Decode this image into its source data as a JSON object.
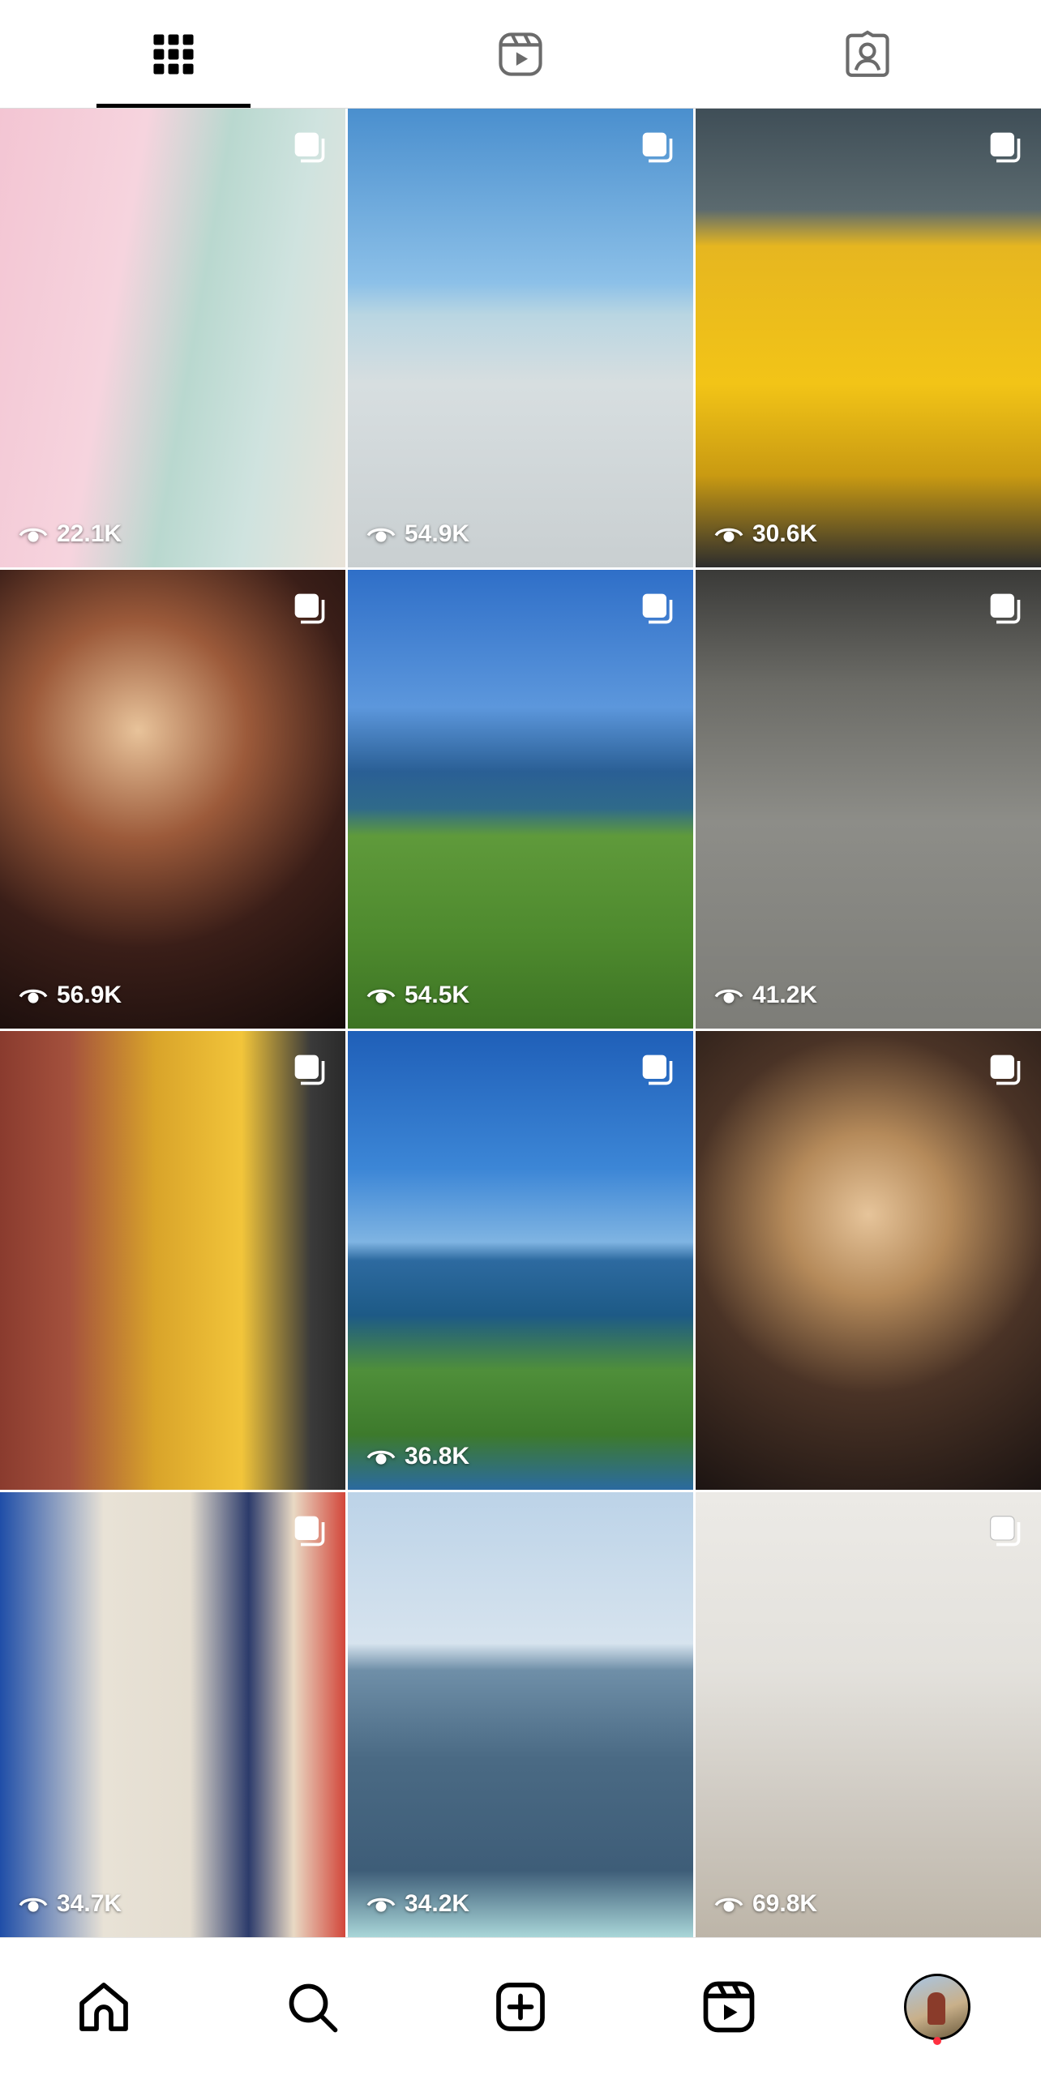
{
  "tabs": [
    {
      "name": "grid-icon",
      "active": true
    },
    {
      "name": "reels-icon",
      "active": false
    },
    {
      "name": "tagged-icon",
      "active": false
    }
  ],
  "posts": [
    {
      "views": "22.1K"
    },
    {
      "views": "54.9K"
    },
    {
      "views": "30.6K"
    },
    {
      "views": "56.9K"
    },
    {
      "views": "54.5K"
    },
    {
      "views": "41.2K"
    },
    {
      "views": ""
    },
    {
      "views": "36.8K"
    },
    {
      "views": ""
    },
    {
      "views": "34.7K"
    },
    {
      "views": "34.2K"
    },
    {
      "views": "69.8K"
    }
  ],
  "bottom_nav": [
    "home-icon",
    "search-icon",
    "create-icon",
    "reels-icon",
    "profile-avatar"
  ],
  "colors": {
    "notification": "#ff3040",
    "active_tab": "#000000"
  }
}
